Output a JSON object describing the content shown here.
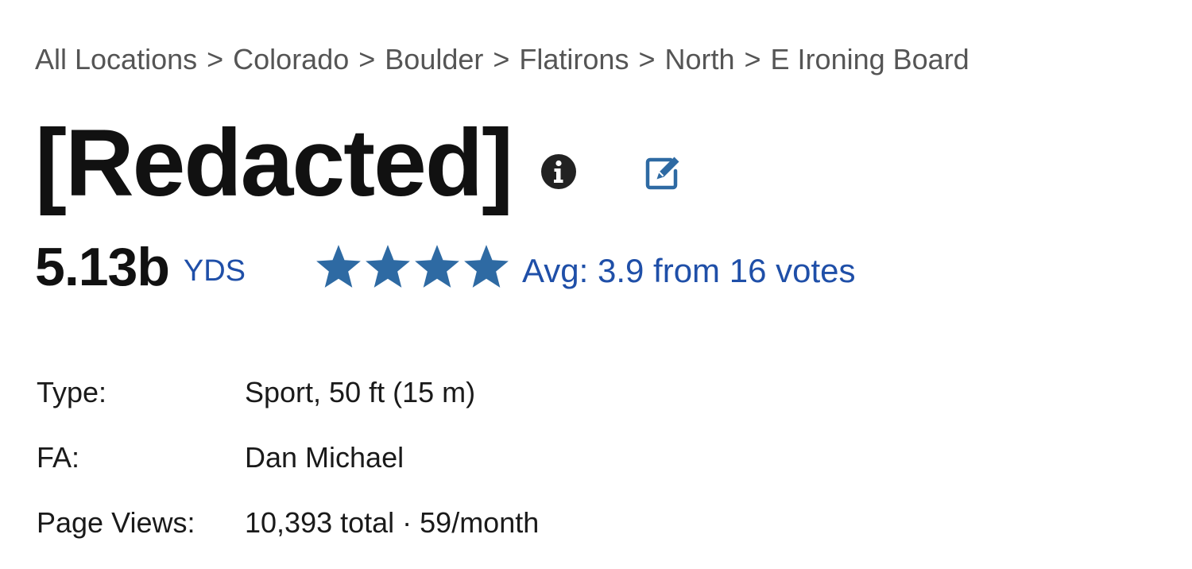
{
  "breadcrumb": {
    "items": [
      "All Locations",
      "Colorado",
      "Boulder",
      "Flatirons",
      "North",
      "E Ironing Board"
    ],
    "separator": ">"
  },
  "route": {
    "title": "[Redacted]",
    "info_icon": "info-circle-icon",
    "edit_icon": "edit-pencil-icon",
    "grade": "5.13b",
    "grade_system": "YDS",
    "stars": {
      "count": 4,
      "icon": "star-icon",
      "color": "#2e6aa3"
    },
    "rating_text": "Avg: 3.9 from 16 votes"
  },
  "details": [
    {
      "label": "Type:",
      "value": "Sport, 50 ft (15 m)"
    },
    {
      "label": "FA:",
      "value": "Dan Michael"
    },
    {
      "label": "Page Views:",
      "value": "10,393 total · 59/month"
    }
  ],
  "colors": {
    "link": "#1f4fa8",
    "star": "#2e6aa3",
    "edit_icon": "#2e6aa3",
    "info_icon": "#222222"
  }
}
